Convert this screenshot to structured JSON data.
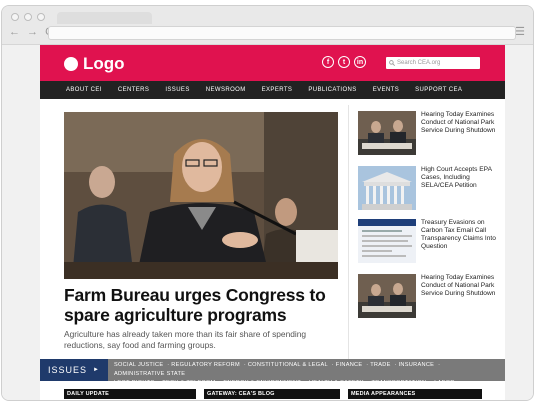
{
  "browser": {
    "nav_icons": "← → C",
    "menu_icon": "☰"
  },
  "header": {
    "logo_text": "Logo",
    "social": [
      "f",
      "t",
      "in"
    ],
    "search_placeholder": "Search CEA.org",
    "brand_color": "#e0124f"
  },
  "nav": {
    "items": [
      "ABOUT CEI",
      "CENTERS",
      "ISSUES",
      "NEWSROOM",
      "EXPERTS",
      "PUBLICATIONS",
      "EVENTS",
      "SUPPORT CEA"
    ]
  },
  "feature": {
    "headline": "Farm Bureau urges Congress to spare agriculture programs",
    "summary": "Agriculture has already taken more than its fair share of spending reductions, say food and farming groups."
  },
  "sidebar": {
    "items": [
      {
        "title": "Hearing Today Examines Conduct of National Park Service During Shutdown"
      },
      {
        "title": "High Court Accepts EPA Cases, Including SELA/CEA Petition"
      },
      {
        "title": "Treasury Evasions on Carbon Tax Email Call Transparency Claims Into Question"
      },
      {
        "title": "Hearing Today Examines Conduct of National Park Service During Shutdown"
      }
    ]
  },
  "issues_bar": {
    "label": "ISSUES",
    "arrow": "►",
    "links": [
      "SOCIAL JUSTICE",
      "REGULATORY REFORM",
      "CONSTITUTIONAL & LEGAL",
      "FINANCE",
      "TRADE",
      "INSURANCE",
      "ADMINISTRATIVE STATE",
      "LBGT RIGHTS",
      "TECH & TELECOM",
      "ENERGY & ENVIRONMENT",
      "HEALTH & SAFETY",
      "TRANSPORTATION",
      "LABOR"
    ],
    "color": "#1f3a6b"
  },
  "bottom_sections": {
    "daily": "DAILY UPDATE",
    "blog": "GATEWAY: CEA'S BLOG",
    "media": "MEDIA APPEARANCES"
  }
}
